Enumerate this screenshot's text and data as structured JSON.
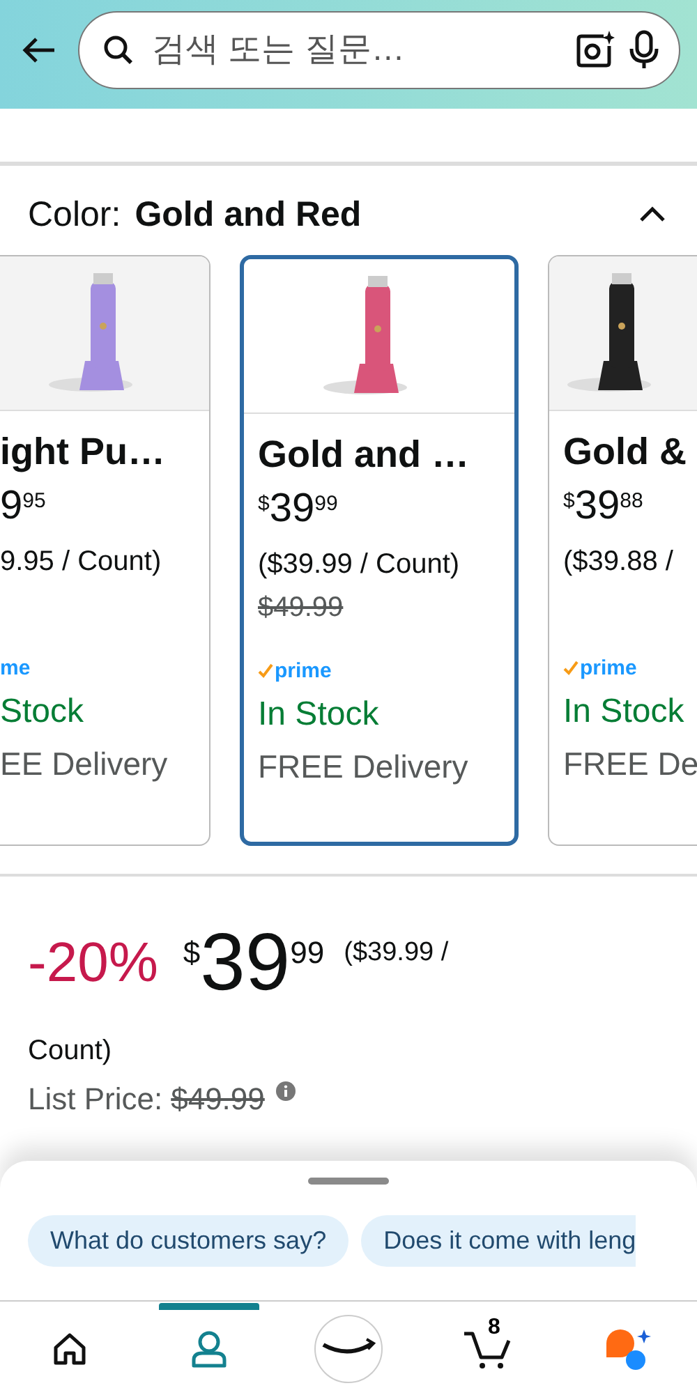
{
  "header": {
    "search": {
      "placeholder": "검색 또는 질문…"
    }
  },
  "color_selector": {
    "label": "Color:",
    "value": "Gold and Red",
    "expanded": true,
    "options": [
      {
        "kind": "cut_left",
        "name": "ight Pu…",
        "price_whole": "9",
        "price_fraction": "95",
        "unit_price": "9.95 / Count)",
        "prime": "me",
        "prime_check": false,
        "availability": "Stock",
        "delivery": "EE Delivery",
        "selected": false
      },
      {
        "kind": "full",
        "name": "Gold and …",
        "price_symbol": "$",
        "price_whole": "39",
        "price_fraction": "99",
        "unit_price": "($39.99 / Count)",
        "list_price": "$49.99",
        "prime": "prime",
        "prime_check": true,
        "availability": "In Stock",
        "delivery": "FREE Delivery",
        "selected": true
      },
      {
        "kind": "cut_right",
        "name": "Gold &",
        "price_symbol": "$",
        "price_whole": "39",
        "price_fraction": "88",
        "unit_price": "($39.88 /",
        "prime": "prime",
        "prime_check": true,
        "availability": "In Stock",
        "delivery": "FREE De",
        "selected": false
      }
    ]
  },
  "price": {
    "discount": "-20%",
    "symbol": "$",
    "whole": "39",
    "fraction": "99",
    "unit_price": "($39.99 /",
    "unit_price_cont": "Count)",
    "list_price_label": "List Price:",
    "list_price": "$49.99"
  },
  "suggestions": [
    "What do customers say?",
    "Does it come with leng"
  ],
  "nav": [
    {
      "kind": "home",
      "selected": false
    },
    {
      "kind": "account",
      "selected": true
    },
    {
      "kind": "logo",
      "selected": false
    },
    {
      "kind": "cart",
      "badge": "8",
      "selected": false
    },
    {
      "kind": "assistant",
      "selected": false
    }
  ]
}
